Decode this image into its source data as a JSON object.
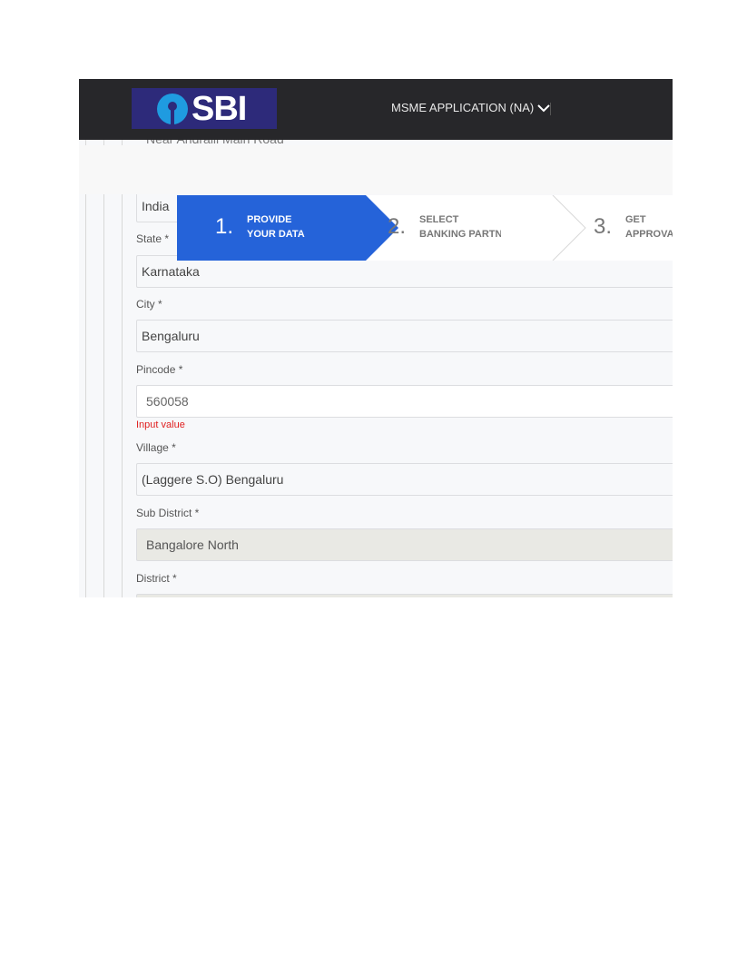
{
  "header": {
    "logo_text": "SBI",
    "menu_label": "MSME APPLICATION (NA)",
    "menu_icon": "chevron-down-icon"
  },
  "partial_text": "Near Andralli Main Road",
  "stepper": {
    "steps": [
      {
        "number": "1.",
        "line1": "PROVIDE",
        "line2": "YOUR DATA",
        "active": true
      },
      {
        "number": "2.",
        "line1": "SELECT",
        "line2": "BANKING PARTN",
        "active": false
      },
      {
        "number": "3.",
        "line1": "GET",
        "line2": "APPROVA",
        "active": false
      }
    ]
  },
  "form": {
    "country_value": "India",
    "state_label": "State *",
    "state_value": "Karnataka",
    "city_label": "City *",
    "city_value": "Bengaluru",
    "pincode_label": "Pincode *",
    "pincode_value": "560058",
    "pincode_error": "Input value",
    "village_label": "Village *",
    "village_value": "(Laggere S.O) Bengaluru",
    "subdistrict_label": "Sub District *",
    "subdistrict_value": "Bangalore North",
    "district_label": "District *"
  },
  "colors": {
    "header_bg": "#27272a",
    "logo_bg": "#2d2a7a",
    "logo_accent": "#1f9be0",
    "step_active": "#2563d9",
    "error": "#e02020"
  }
}
